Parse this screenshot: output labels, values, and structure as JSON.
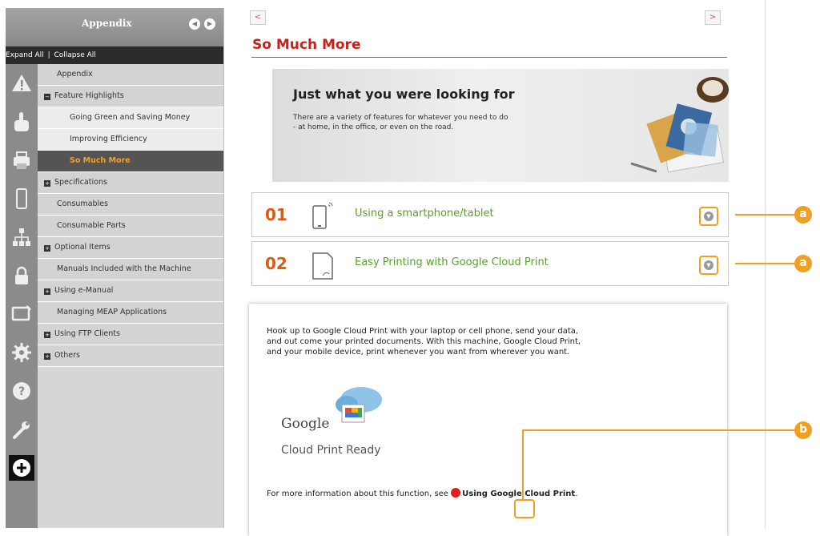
{
  "sidebar": {
    "title": "Appendix",
    "prev_button": "◀",
    "next_button": "▶",
    "expand_all": "Expand All",
    "collapse_all": "Collapse All",
    "separator": "|",
    "items": [
      {
        "label": "Appendix",
        "level": 0,
        "toggle": ""
      },
      {
        "label": "Feature Highlights",
        "level": 0,
        "toggle": "−"
      },
      {
        "label": "Going Green and Saving Money",
        "level": 1,
        "toggle": ""
      },
      {
        "label": "Improving Efficiency",
        "level": 1,
        "toggle": ""
      },
      {
        "label": "So Much More",
        "level": 1,
        "toggle": "",
        "active": true
      },
      {
        "label": "Specifications",
        "level": 0,
        "toggle": "+"
      },
      {
        "label": "Consumables",
        "level": 0,
        "toggle": ""
      },
      {
        "label": "Consumable Parts",
        "level": 0,
        "toggle": ""
      },
      {
        "label": "Optional Items",
        "level": 0,
        "toggle": "+"
      },
      {
        "label": "Manuals Included with the Machine",
        "level": 0,
        "toggle": ""
      },
      {
        "label": "Using e-Manual",
        "level": 0,
        "toggle": "+"
      },
      {
        "label": "Managing MEAP Applications",
        "level": 0,
        "toggle": ""
      },
      {
        "label": "Using FTP Clients",
        "level": 0,
        "toggle": "+"
      },
      {
        "label": "Others",
        "level": 0,
        "toggle": "+"
      }
    ],
    "rail_icons": [
      "warning-icon",
      "hand-icon",
      "printer-icon",
      "phone-icon",
      "network-icon",
      "lock-icon",
      "display-icon",
      "gear-icon",
      "help-icon",
      "wrench-icon",
      "plus-icon"
    ]
  },
  "main": {
    "prev_arrow": "<",
    "next_arrow": ">",
    "title": "So Much More",
    "banner": {
      "heading": "Just what you were looking for",
      "text_line1": "There are a variety of features for whatever you need to do",
      "text_line2": "- at home, in the office, or even on the road."
    },
    "accordions": [
      {
        "number": "01",
        "label": "Using a smartphone/tablet"
      },
      {
        "number": "02",
        "label": "Easy Printing with Google Cloud Print"
      }
    ],
    "detail": {
      "line1": "Hook up to Google Cloud Print with your laptop or cell phone, send your data,",
      "line2": "and out come your printed documents. With this machine, Google Cloud Print,",
      "line3": "and your mobile device, print whenever you want from wherever you want.",
      "logo_word": "Google",
      "logo_sub": "Cloud Print Ready",
      "more_prefix": "For more information about this function, see",
      "more_link": "Using Google Cloud Print",
      "more_suffix": "."
    }
  },
  "callouts": {
    "a": "a",
    "b": "b"
  },
  "colors": {
    "accent": "#f0a020",
    "title_red": "#c8201a",
    "green": "#5aa02c",
    "number_orange": "#e05a10"
  }
}
